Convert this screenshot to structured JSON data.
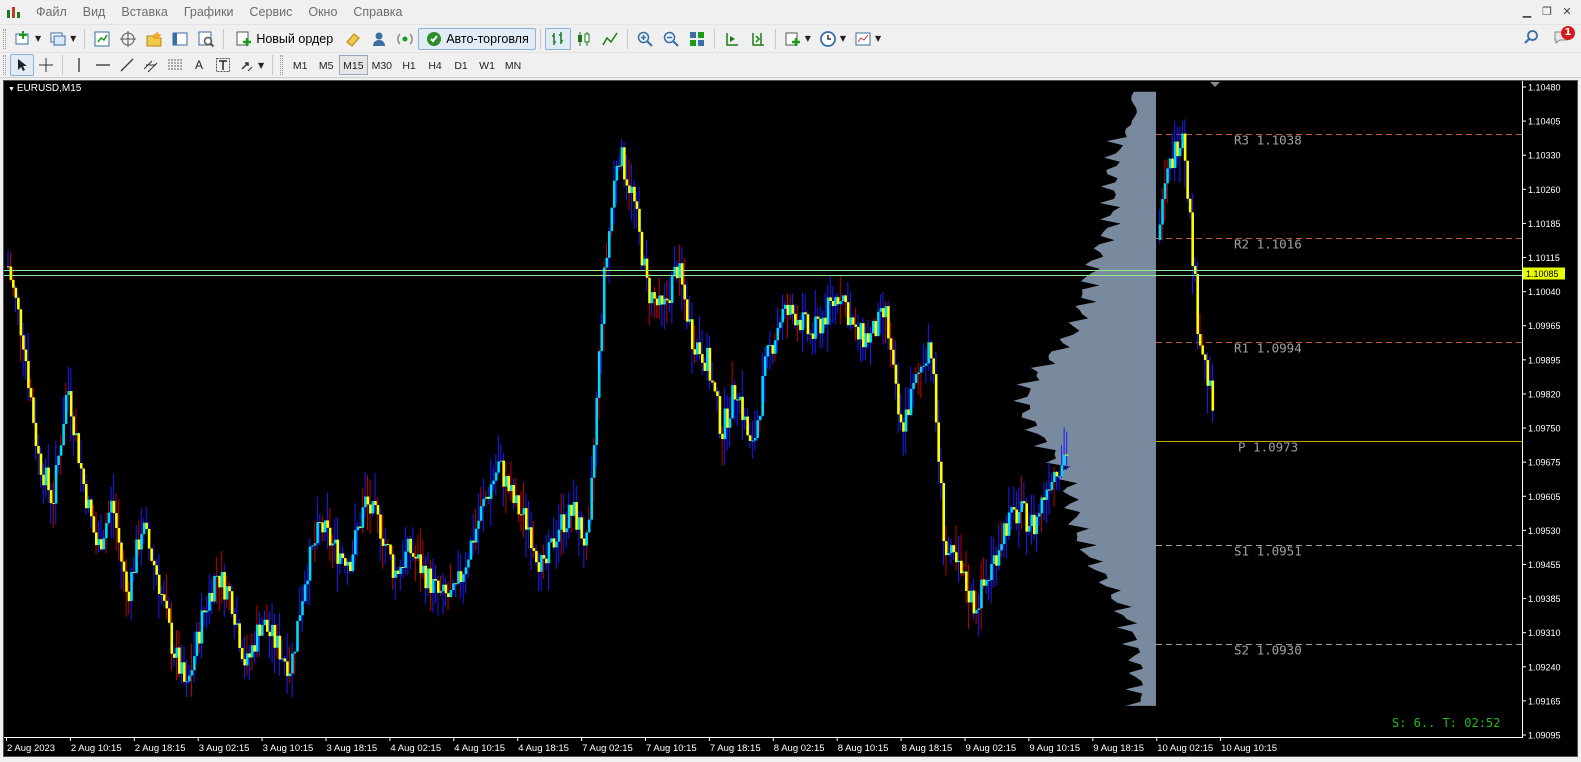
{
  "menu": {
    "items": [
      "Файл",
      "Вид",
      "Вставка",
      "Графики",
      "Сервис",
      "Окно",
      "Справка"
    ]
  },
  "toolbar": {
    "new_order_label": "Новый ордер",
    "autotrading_label": "Авто-торговля",
    "notification_count": "1",
    "timeframes": [
      "M1",
      "M5",
      "M15",
      "M30",
      "H1",
      "H4",
      "D1",
      "W1",
      "MN"
    ],
    "active_timeframe": "M15"
  },
  "chart": {
    "symbol_label": "EURUSD,M15",
    "current_price": "1.10085",
    "status_text": "S: 6.. T: 02:52",
    "colors": {
      "background": "#000000",
      "bull": "#00d5ff",
      "bear": "#ffff00",
      "wick": "#1a1aff",
      "wick_red": "#c00000",
      "volume_profile": "#7a8a9e",
      "pivot_line": "#c8a000",
      "resistance_line": "#c0603a",
      "support_line": "#a0a0a0",
      "price_line": "#90ee90",
      "label_color": "#a0a0a0"
    }
  },
  "chart_data": {
    "type": "candlestick",
    "symbol": "EURUSD,M15",
    "ylim": [
      1.0909,
      1.1048
    ],
    "y_ticks": [
      "1.10480",
      "1.10405",
      "1.10330",
      "1.10260",
      "1.10185",
      "1.10115",
      "1.10040",
      "1.09965",
      "1.09895",
      "1.09820",
      "1.09750",
      "1.09675",
      "1.09605",
      "1.09530",
      "1.09455",
      "1.09385",
      "1.09310",
      "1.09240",
      "1.09165",
      "1.09095"
    ],
    "x_ticks": [
      "2 Aug 2023",
      "2 Aug 10:15",
      "2 Aug 18:15",
      "3 Aug 02:15",
      "3 Aug 10:15",
      "3 Aug 18:15",
      "4 Aug 02:15",
      "4 Aug 10:15",
      "4 Aug 18:15",
      "7 Aug 02:15",
      "7 Aug 10:15",
      "7 Aug 18:15",
      "8 Aug 02:15",
      "8 Aug 10:15",
      "8 Aug 18:15",
      "9 Aug 02:15",
      "9 Aug 10:15",
      "9 Aug 18:15",
      "10 Aug 02:15",
      "10 Aug 10:15"
    ],
    "close_path": [
      1.101,
      1.0995,
      1.097,
      1.096,
      1.0985,
      1.0965,
      1.095,
      1.096,
      1.094,
      1.0955,
      1.0945,
      1.093,
      1.092,
      1.0935,
      1.0945,
      1.094,
      1.0925,
      1.0935,
      1.093,
      1.0925,
      1.0945,
      1.0955,
      1.095,
      1.0948,
      1.096,
      1.0955,
      1.0945,
      1.095,
      1.0945,
      1.094,
      1.094,
      1.095,
      1.096,
      1.0968,
      1.096,
      1.0955,
      1.0945,
      1.0955,
      1.0958,
      1.095,
      1.1005,
      1.1035,
      1.1025,
      1.1005,
      1.1,
      1.101,
      1.0995,
      1.099,
      1.0975,
      1.0985,
      1.097,
      1.099,
      1.1,
      1.1,
      1.0995,
      1.1,
      1.1005,
      1.0995,
      1.0995,
      1.1,
      1.0975,
      1.0985,
      1.0995,
      1.095,
      1.0945,
      1.0938,
      1.0945,
      1.0955,
      1.0958,
      1.0955,
      1.0965,
      1.097,
      1.0975,
      1.098,
      1.0985,
      1.0995,
      1.1,
      1.101,
      1.103,
      1.104,
      1.0998,
      1.098
    ],
    "volume_profile_window": "9 Aug 18:15 – 10 Aug 02:15",
    "pivot_levels": [
      {
        "label": "R3",
        "value": "1.1038"
      },
      {
        "label": "R2",
        "value": "1.1016"
      },
      {
        "label": "R1",
        "value": "1.0994"
      },
      {
        "label": "P",
        "value": "1.0973"
      },
      {
        "label": "S1",
        "value": "1.0951"
      },
      {
        "label": "S2",
        "value": "1.0930"
      }
    ],
    "current_price": 1.10085
  }
}
